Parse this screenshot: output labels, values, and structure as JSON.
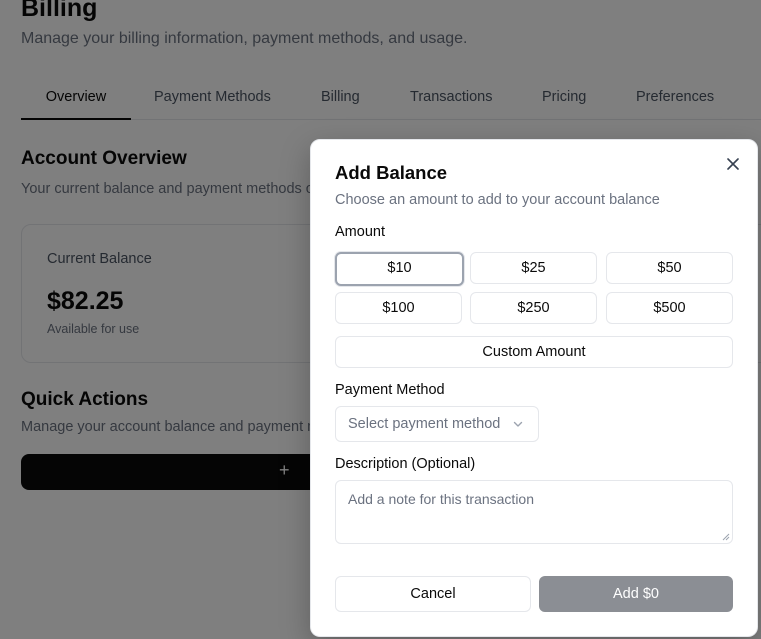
{
  "page": {
    "title": "Billing",
    "subtitle": "Manage your billing information, payment methods, and usage."
  },
  "tabs": [
    {
      "label": "Overview",
      "active": true
    },
    {
      "label": "Payment Methods",
      "active": false
    },
    {
      "label": "Billing",
      "active": false
    },
    {
      "label": "Transactions",
      "active": false
    },
    {
      "label": "Pricing",
      "active": false
    },
    {
      "label": "Preferences",
      "active": false
    }
  ],
  "account_overview": {
    "title": "Account Overview",
    "description": "Your current balance and payment methods o",
    "balance_card": {
      "label": "Current Balance",
      "value": "$82.25",
      "note": "Available for use"
    }
  },
  "quick_actions": {
    "title": "Quick Actions",
    "description": "Manage your account balance and payment m",
    "add_icon": "plus-icon"
  },
  "dialog": {
    "title": "Add Balance",
    "description": "Choose an amount to add to your account balance",
    "close_icon": "close-icon",
    "amount_label": "Amount",
    "amounts": [
      {
        "label": "$10",
        "selected": true
      },
      {
        "label": "$25",
        "selected": false
      },
      {
        "label": "$50",
        "selected": false
      },
      {
        "label": "$100",
        "selected": false
      },
      {
        "label": "$250",
        "selected": false
      },
      {
        "label": "$500",
        "selected": false
      }
    ],
    "custom_amount_label": "Custom Amount",
    "payment_method_label": "Payment Method",
    "payment_method_placeholder": "Select payment method",
    "description_label": "Description (Optional)",
    "description_placeholder": "Add a note for this transaction",
    "cancel_label": "Cancel",
    "submit_label": "Add $0"
  },
  "colors": {
    "primary": "#0a0a0a",
    "muted_text": "#6b7280",
    "border": "#e5e7eb",
    "disabled_button": "#8b8e94",
    "overlay": "rgba(0,0,0,0.5)"
  }
}
